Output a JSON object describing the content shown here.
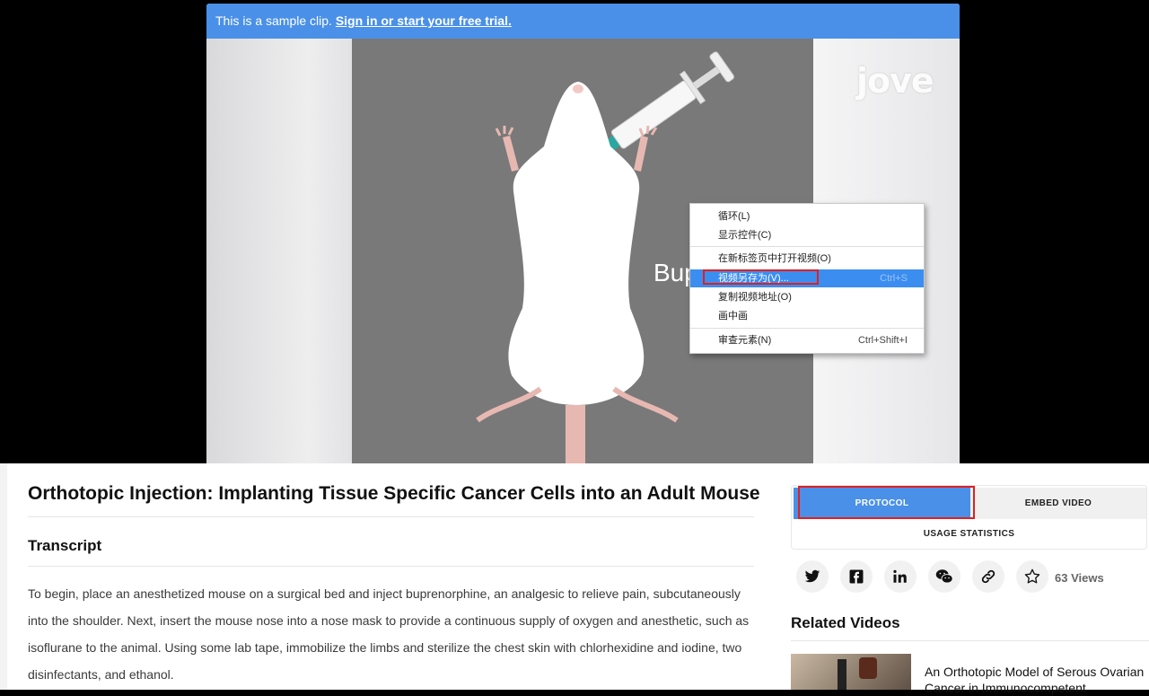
{
  "sample_bar": {
    "text": "This is a sample clip.",
    "link": "Sign in or start your free trial."
  },
  "video": {
    "logo": "jove",
    "caption_partial": "Bup"
  },
  "context_menu": {
    "items": [
      {
        "label": "循环(L)",
        "shortcut": ""
      },
      {
        "label": "显示控件(C)",
        "shortcut": ""
      },
      {
        "label": "在新标签页中打开视频(O)",
        "shortcut": ""
      },
      {
        "label": "视频另存为(V)...",
        "shortcut": "Ctrl+S"
      },
      {
        "label": "复制视频地址(O)",
        "shortcut": ""
      },
      {
        "label": "画中画",
        "shortcut": ""
      },
      {
        "label": "审查元素(N)",
        "shortcut": "Ctrl+Shift+I"
      }
    ]
  },
  "article": {
    "title": "Orthotopic Injection: Implanting Tissue Specific Cancer Cells into an Adult Mouse",
    "transcript_heading": "Transcript",
    "transcript_text": "To begin, place an anesthetized mouse on a surgical bed and inject buprenorphine, an analgesic to relieve pain, subcutaneously into the shoulder. Next, insert the mouse nose into a nose mask to provide a continuous supply of oxygen and anesthetic, such as isoflurane to the animal. Using some lab tape, immobilize the limbs and sterilize the chest skin with chlorhexidine and iodine, two disinfectants, and ethanol."
  },
  "sidebar": {
    "tabs": {
      "protocol": "PROTOCOL",
      "embed": "EMBED VIDEO",
      "usage": "USAGE STATISTICS"
    },
    "share_icons": [
      "twitter-icon",
      "facebook-icon",
      "linkedin-icon",
      "wechat-icon",
      "link-icon",
      "star-icon"
    ],
    "views": "63 Views",
    "related_heading": "Related Videos",
    "related_item_title": "An Orthotopic Model of Serous Ovarian Cancer in Immunocompetent"
  },
  "colors": {
    "accent": "#4a90e8",
    "highlight_box": "#e02020",
    "menu_highlight": "#3b8ef0"
  }
}
